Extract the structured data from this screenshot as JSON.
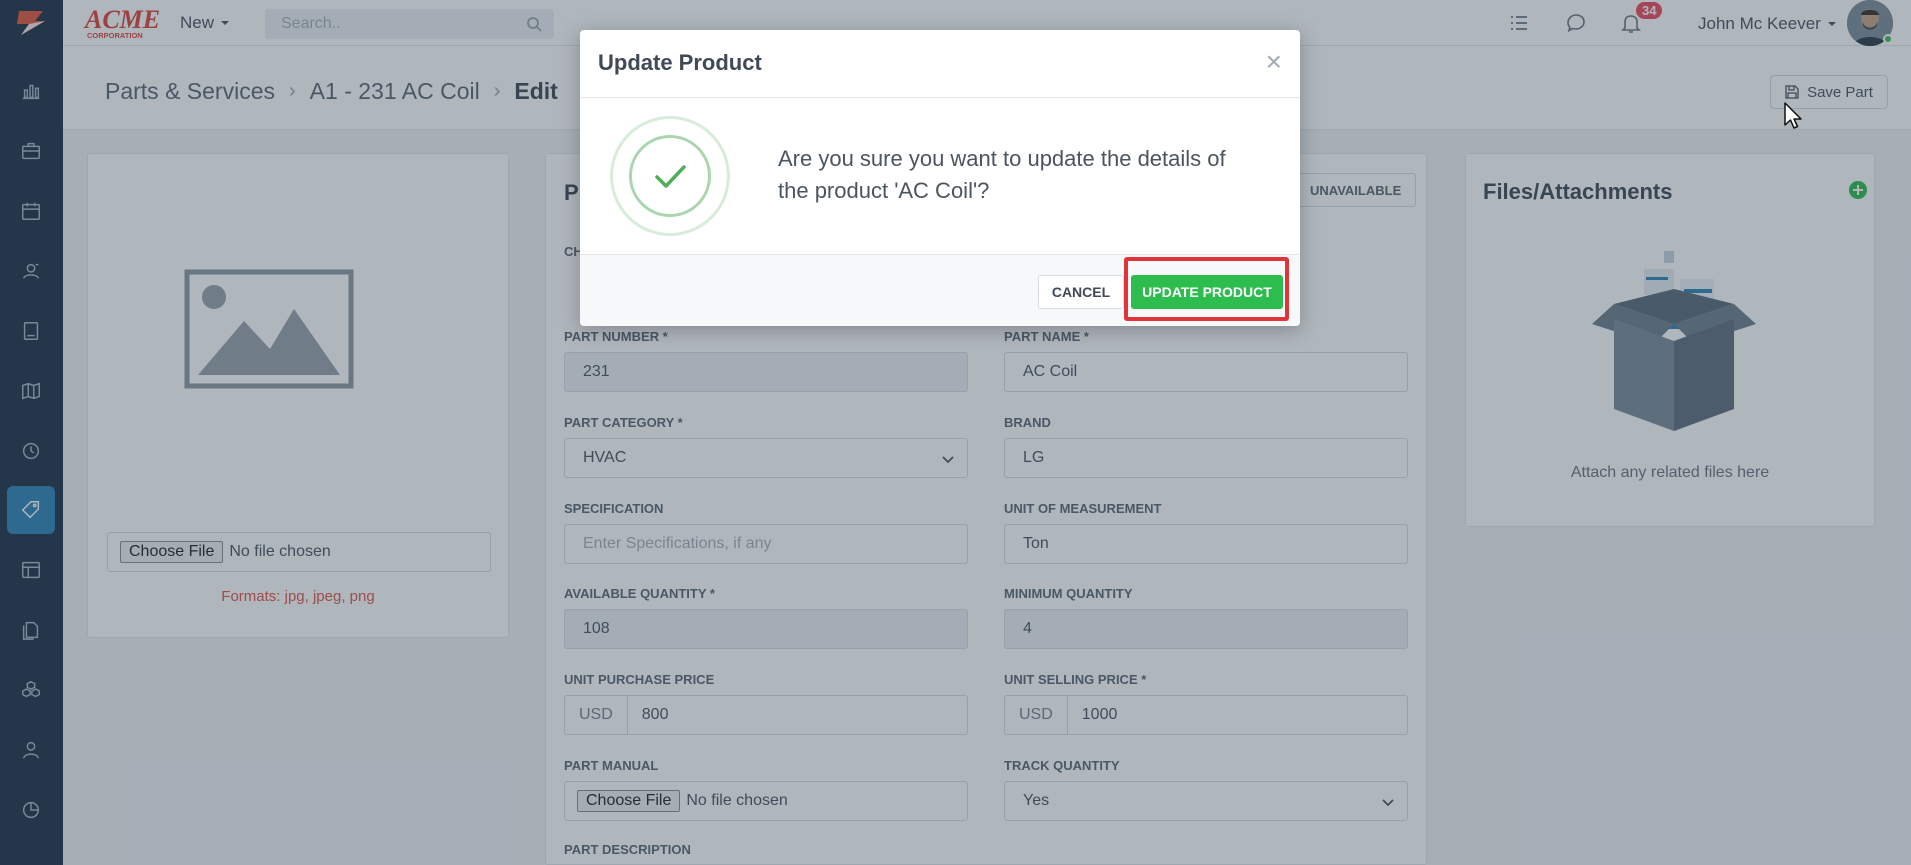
{
  "topbar": {
    "brand": "ACME",
    "brand_sub": "CORPORATION",
    "new_label": "New",
    "search_placeholder": "Search..",
    "notification_count": "34",
    "user_name": "John Mc Keever"
  },
  "breadcrumb": {
    "items": [
      "Parts & Services",
      "A1 - 231 AC Coil"
    ],
    "current": "Edit"
  },
  "header": {
    "save_label": "Save Part"
  },
  "image_card": {
    "choose_file": "Choose File",
    "no_file": "No file chosen",
    "formats": "Formats: jpg, jpeg, png"
  },
  "form": {
    "title": "P",
    "status_button": "UNAVAILABLE",
    "hidden_label": "CH",
    "part_number_label": "PART NUMBER *",
    "part_number": "231",
    "part_name_label": "PART NAME *",
    "part_name": "AC Coil",
    "category_label": "PART CATEGORY *",
    "category": "HVAC",
    "brand_label": "BRAND",
    "brand": "LG",
    "spec_label": "SPECIFICATION",
    "spec_placeholder": "Enter Specifications, if any",
    "uom_label": "UNIT OF MEASUREMENT",
    "uom": "Ton",
    "avail_qty_label": "AVAILABLE QUANTITY *",
    "avail_qty": "108",
    "min_qty_label": "MINIMUM QUANTITY",
    "min_qty": "4",
    "purchase_label": "UNIT PURCHASE PRICE",
    "currency": "USD",
    "purchase_price": "800",
    "selling_label": "UNIT SELLING PRICE *",
    "selling_price": "1000",
    "manual_label": "PART MANUAL",
    "manual_choose": "Choose File",
    "manual_no_file": "No file chosen",
    "track_label": "TRACK QUANTITY",
    "track": "Yes",
    "desc_label": "PART DESCRIPTION"
  },
  "files": {
    "title": "Files/Attachments",
    "hint": "Attach any related files here"
  },
  "modal": {
    "title": "Update Product",
    "close": "×",
    "message": "Are you sure you want to update the details of the product 'AC Coil'?",
    "cancel": "CANCEL",
    "confirm": "UPDATE PRODUCT"
  },
  "colors": {
    "sidebar": "#1f3147",
    "accent": "#2f84b6",
    "success": "#2dbd4e",
    "highlight": "#e0333a",
    "error_text": "#e2574c"
  },
  "sidebar_icons": [
    "reports-icon",
    "briefcase-icon",
    "calendar-icon",
    "contacts-icon",
    "invoice-icon",
    "map-icon",
    "clock-icon",
    "tag-icon",
    "table-icon",
    "documents-icon",
    "cubes-icon",
    "user-icon",
    "pie-chart-icon"
  ]
}
